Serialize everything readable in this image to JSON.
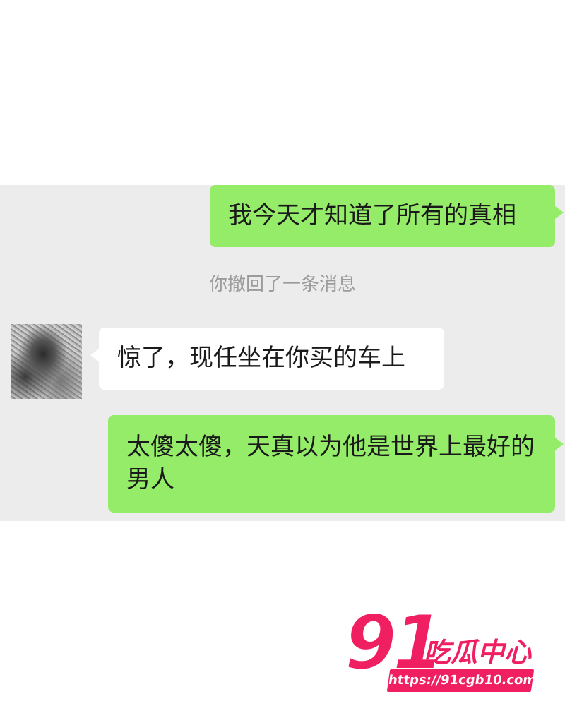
{
  "chat": {
    "messages": [
      {
        "direction": "outgoing",
        "text": "我今天才知道了所有的真相"
      },
      {
        "direction": "system",
        "text": "你撤回了一条消息"
      },
      {
        "direction": "incoming",
        "text": "惊了，现任坐在你买的车上",
        "avatar_icon": "user-avatar"
      },
      {
        "direction": "outgoing",
        "text": "太傻太傻，天真以为他是世界上最好的男人"
      }
    ],
    "colors": {
      "outgoing_bubble": "#95ec69",
      "incoming_bubble": "#ffffff",
      "panel_background": "#ececec",
      "system_text": "#9b9b9b"
    }
  },
  "watermark": {
    "number": "91",
    "brand": "吃瓜中心",
    "url": "https://91cgb10.com",
    "color": "#ef1f62"
  }
}
